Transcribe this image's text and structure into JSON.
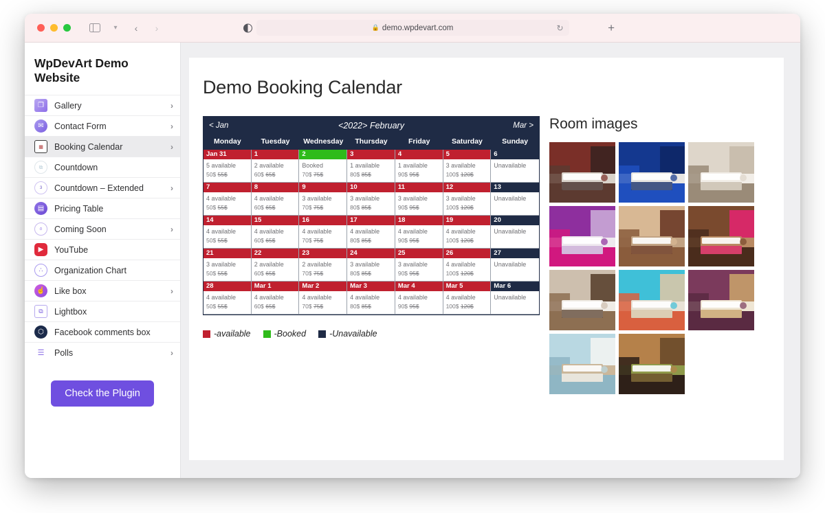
{
  "browser": {
    "url": "demo.wpdevart.com",
    "lock_icon": "lock-icon",
    "reload_icon": "reload-icon",
    "new_tab_icon": "plus-icon",
    "back_icon": "chevron-left-icon",
    "forward_icon": "chevron-right-icon",
    "sidebar_icon": "sidebar-toggle-icon",
    "sidebar_chevron": "chevron-down-icon",
    "reader_icon": "contrast-icon"
  },
  "sidebar": {
    "title": "WpDevArt Demo Website",
    "items": [
      {
        "label": "Gallery",
        "icon": "gallery-icon",
        "arrow": "›",
        "has_arrow": true,
        "active": false
      },
      {
        "label": "Contact Form",
        "icon": "envelope-icon",
        "arrow": "›",
        "has_arrow": true,
        "active": false
      },
      {
        "label": "Booking Calendar",
        "icon": "calendar-icon",
        "arrow": "›",
        "has_arrow": true,
        "active": true
      },
      {
        "label": "Countdown",
        "icon": "countdown-icon",
        "arrow": "",
        "has_arrow": false,
        "active": false
      },
      {
        "label": "Countdown – Extended",
        "icon": "countdown-extended-icon",
        "arrow": "›",
        "has_arrow": true,
        "active": false
      },
      {
        "label": "Pricing Table",
        "icon": "pricing-table-icon",
        "arrow": "",
        "has_arrow": false,
        "active": false
      },
      {
        "label": "Coming Soon",
        "icon": "coming-soon-icon",
        "arrow": "›",
        "has_arrow": true,
        "active": false
      },
      {
        "label": "YouTube",
        "icon": "youtube-icon",
        "arrow": "",
        "has_arrow": false,
        "active": false
      },
      {
        "label": "Organization Chart",
        "icon": "organization-chart-icon",
        "arrow": "",
        "has_arrow": false,
        "active": false
      },
      {
        "label": "Like box",
        "icon": "thumbs-up-icon",
        "arrow": "›",
        "has_arrow": true,
        "active": false
      },
      {
        "label": "Lightbox",
        "icon": "lightbox-icon",
        "arrow": "",
        "has_arrow": false,
        "active": false
      },
      {
        "label": "Facebook comments box",
        "icon": "facebook-comments-icon",
        "arrow": "",
        "has_arrow": false,
        "active": false
      },
      {
        "label": "Polls",
        "icon": "polls-icon",
        "arrow": "›",
        "has_arrow": true,
        "active": false
      }
    ],
    "cta_label": "Check the Plugin"
  },
  "main": {
    "page_title": "Demo Booking Calendar",
    "rooms_title": "Room images"
  },
  "calendar": {
    "prev_label": "< Jan",
    "next_label": "Mar >",
    "year_label": "<2022>",
    "month_label": "February",
    "day_names": [
      "Monday",
      "Tuesday",
      "Wednesday",
      "Thursday",
      "Friday",
      "Saturday",
      "Sunday"
    ],
    "colors": {
      "available": "#c0202f",
      "booked": "#2fbb1a",
      "unavailable": "#1f2b45"
    },
    "legend": [
      {
        "swatch": "available",
        "label": "-available"
      },
      {
        "swatch": "booked",
        "label": "-Booked"
      },
      {
        "swatch": "unavailable",
        "label": "-Unavailable"
      }
    ],
    "weeks": [
      [
        {
          "date": "Jan 31",
          "status": "5 available",
          "price": "50$",
          "old_price": "55$",
          "state": "available"
        },
        {
          "date": "1",
          "status": "2 available",
          "price": "60$",
          "old_price": "65$",
          "state": "available"
        },
        {
          "date": "2",
          "status": "Booked",
          "price": "70$",
          "old_price": "75$",
          "state": "booked"
        },
        {
          "date": "3",
          "status": "1 available",
          "price": "80$",
          "old_price": "85$",
          "state": "available"
        },
        {
          "date": "4",
          "status": "1 available",
          "price": "90$",
          "old_price": "95$",
          "state": "available"
        },
        {
          "date": "5",
          "status": "3 available",
          "price": "100$",
          "old_price": "120$",
          "state": "available"
        },
        {
          "date": "6",
          "status": "Unavailable",
          "price": "",
          "old_price": "",
          "state": "unavailable"
        }
      ],
      [
        {
          "date": "7",
          "status": "4 available",
          "price": "50$",
          "old_price": "55$",
          "state": "available"
        },
        {
          "date": "8",
          "status": "4 available",
          "price": "60$",
          "old_price": "65$",
          "state": "available"
        },
        {
          "date": "9",
          "status": "3 available",
          "price": "70$",
          "old_price": "75$",
          "state": "available"
        },
        {
          "date": "10",
          "status": "3 available",
          "price": "80$",
          "old_price": "85$",
          "state": "available"
        },
        {
          "date": "11",
          "status": "3 available",
          "price": "90$",
          "old_price": "95$",
          "state": "available"
        },
        {
          "date": "12",
          "status": "3 available",
          "price": "100$",
          "old_price": "120$",
          "state": "available"
        },
        {
          "date": "13",
          "status": "Unavailable",
          "price": "",
          "old_price": "",
          "state": "unavailable"
        }
      ],
      [
        {
          "date": "14",
          "status": "4 available",
          "price": "50$",
          "old_price": "55$",
          "state": "available"
        },
        {
          "date": "15",
          "status": "4 available",
          "price": "60$",
          "old_price": "65$",
          "state": "available"
        },
        {
          "date": "16",
          "status": "4 available",
          "price": "70$",
          "old_price": "75$",
          "state": "available"
        },
        {
          "date": "17",
          "status": "4 available",
          "price": "80$",
          "old_price": "85$",
          "state": "available"
        },
        {
          "date": "18",
          "status": "4 available",
          "price": "90$",
          "old_price": "95$",
          "state": "available"
        },
        {
          "date": "19",
          "status": "4 available",
          "price": "100$",
          "old_price": "120$",
          "state": "available"
        },
        {
          "date": "20",
          "status": "Unavailable",
          "price": "",
          "old_price": "",
          "state": "unavailable"
        }
      ],
      [
        {
          "date": "21",
          "status": "3 available",
          "price": "50$",
          "old_price": "55$",
          "state": "available"
        },
        {
          "date": "22",
          "status": "2 available",
          "price": "60$",
          "old_price": "65$",
          "state": "available"
        },
        {
          "date": "23",
          "status": "2 available",
          "price": "70$",
          "old_price": "75$",
          "state": "available"
        },
        {
          "date": "24",
          "status": "3 available",
          "price": "80$",
          "old_price": "85$",
          "state": "available"
        },
        {
          "date": "25",
          "status": "3 available",
          "price": "90$",
          "old_price": "95$",
          "state": "available"
        },
        {
          "date": "26",
          "status": "4 available",
          "price": "100$",
          "old_price": "120$",
          "state": "available"
        },
        {
          "date": "27",
          "status": "Unavailable",
          "price": "",
          "old_price": "",
          "state": "unavailable"
        }
      ],
      [
        {
          "date": "28",
          "status": "4 available",
          "price": "50$",
          "old_price": "55$",
          "state": "available"
        },
        {
          "date": "Mar 1",
          "status": "4 available",
          "price": "60$",
          "old_price": "65$",
          "state": "available"
        },
        {
          "date": "Mar 2",
          "status": "4 available",
          "price": "70$",
          "old_price": "75$",
          "state": "available"
        },
        {
          "date": "Mar 3",
          "status": "4 available",
          "price": "80$",
          "old_price": "85$",
          "state": "available"
        },
        {
          "date": "Mar 4",
          "status": "4 available",
          "price": "90$",
          "old_price": "95$",
          "state": "available"
        },
        {
          "date": "Mar 5",
          "status": "4 available",
          "price": "100$",
          "old_price": "120$",
          "state": "available"
        },
        {
          "date": "Mar 6",
          "status": "Unavailable",
          "price": "",
          "old_price": "",
          "state": "unavailable"
        }
      ]
    ]
  },
  "rooms": {
    "thumbs": [
      {
        "name": "room-red-curtains-chandelier",
        "c1": "#7a2f28",
        "c2": "#3b2420",
        "c3": "#d9d3cb",
        "c4": "#5c3a30"
      },
      {
        "name": "room-blue-accent-wall",
        "c1": "#14388f",
        "c2": "#0d2766",
        "c3": "#e8e6e2",
        "c4": "#1f4fbe"
      },
      {
        "name": "room-beige-neutral",
        "c1": "#ded6ca",
        "c2": "#c6bbab",
        "c3": "#f2eee8",
        "c4": "#9a8b78"
      },
      {
        "name": "room-purple-magenta",
        "c1": "#8e2f9e",
        "c2": "#c9a9d6",
        "c3": "#efe9ef",
        "c4": "#d1187f"
      },
      {
        "name": "room-warm-brown-classic",
        "c1": "#d8b894",
        "c2": "#6b3a26",
        "c3": "#c2a383",
        "c4": "#8a5c3c"
      },
      {
        "name": "room-pink-headboard-brown-bed",
        "c1": "#7a4a2e",
        "c2": "#e0266e",
        "c3": "#b98a62",
        "c4": "#4a2c1c"
      },
      {
        "name": "room-modern-twin-beds",
        "c1": "#cdbfae",
        "c2": "#5b4330",
        "c3": "#f0ece6",
        "c4": "#8d6f52"
      },
      {
        "name": "room-ocean-view-balcony",
        "c1": "#3fc0d8",
        "c2": "#d8c7a8",
        "c3": "#e8e2d6",
        "c4": "#d9603f"
      },
      {
        "name": "room-purple-wood-tropical",
        "c1": "#7b3a5c",
        "c2": "#c7a06a",
        "c3": "#efe6d4",
        "c4": "#5a2a42"
      },
      {
        "name": "room-light-blue-cottage",
        "c1": "#b9d8e2",
        "c2": "#f2f4f2",
        "c3": "#cbb79a",
        "c4": "#8fb6c4"
      },
      {
        "name": "room-rustic-wood-beams-lounge",
        "c1": "#b5814a",
        "c2": "#6a4a2a",
        "c3": "#8f9a4a",
        "c4": "#2e2018"
      }
    ]
  }
}
